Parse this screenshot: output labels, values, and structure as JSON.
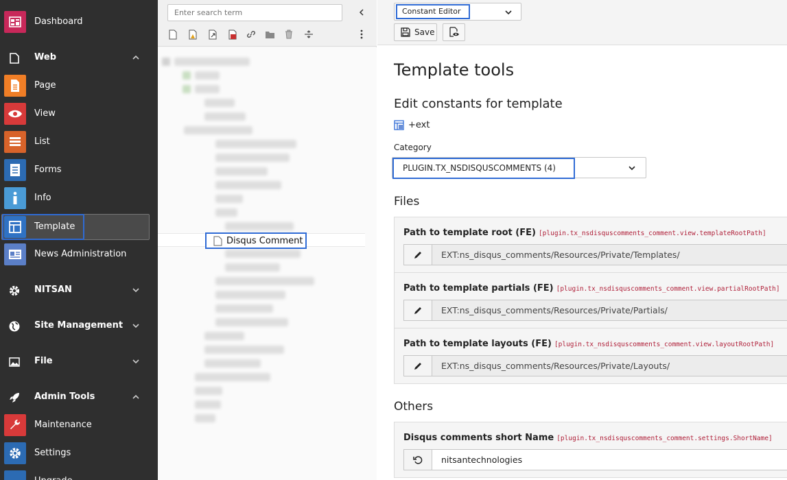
{
  "sidebar": {
    "dashboard": "Dashboard",
    "groups": {
      "web": "Web",
      "nitsan": "NITSAN",
      "site_management": "Site Management",
      "file": "File",
      "admin_tools": "Admin Tools"
    },
    "web_items": [
      "Page",
      "View",
      "List",
      "Forms",
      "Info",
      "Template",
      "News Administration"
    ],
    "admin_items": [
      "Maintenance",
      "Settings",
      "Upgrade"
    ]
  },
  "tree": {
    "search_placeholder": "Enter search term",
    "selected_node": "Disqus Comment"
  },
  "main": {
    "mode_select": "Constant Editor",
    "save_label": "Save",
    "title": "Template tools",
    "subtitle": "Edit constants for template",
    "template_name": "+ext",
    "category_label": "Category",
    "category_value": "PLUGIN.TX_NSDISQUSCOMMENTS (4)",
    "files_title": "Files",
    "others_title": "Others",
    "files": [
      {
        "label": "Path to template root (FE)",
        "key": "[plugin.tx_nsdisquscomments_comment.view.templateRootPath]",
        "value": "EXT:ns_disqus_comments/Resources/Private/Templates/"
      },
      {
        "label": "Path to template partials (FE)",
        "key": "[plugin.tx_nsdisquscomments_comment.view.partialRootPath]",
        "value": "EXT:ns_disqus_comments/Resources/Private/Partials/"
      },
      {
        "label": "Path to template layouts (FE)",
        "key": "[plugin.tx_nsdisquscomments_comment.view.layoutRootPath]",
        "value": "EXT:ns_disqus_comments/Resources/Private/Layouts/"
      }
    ],
    "others": [
      {
        "label": "Disqus comments short Name",
        "key": "[plugin.tx_nsdisquscomments_comment.settings.ShortName]",
        "value": "nitsantechnologies"
      }
    ]
  },
  "colors": {
    "sidebar_bg": "#2f2f2f",
    "highlight": "#2f6bd5",
    "key_text": "#b0213a"
  }
}
